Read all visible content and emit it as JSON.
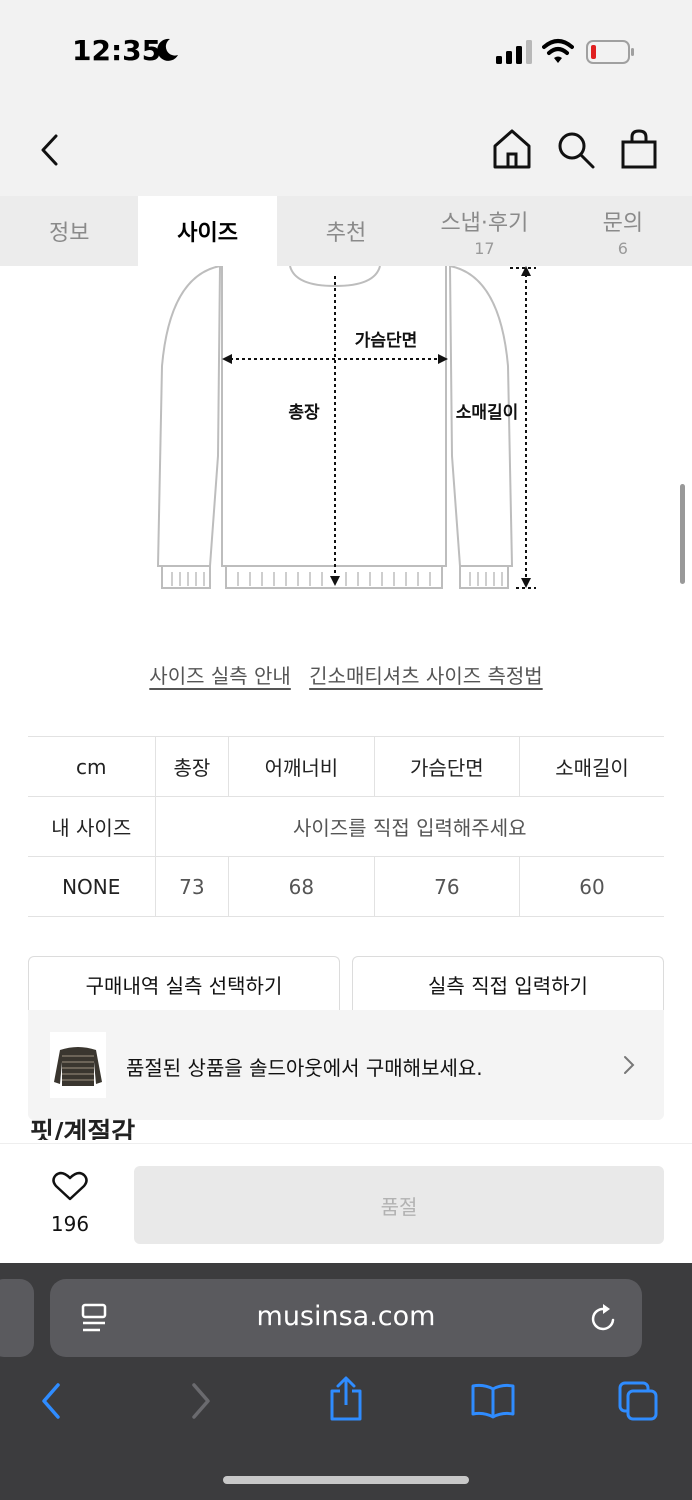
{
  "status": {
    "time": "12:35"
  },
  "tabs": [
    {
      "label": "정보",
      "count": ""
    },
    {
      "label": "사이즈",
      "count": ""
    },
    {
      "label": "추천",
      "count": ""
    },
    {
      "label": "스냅·후기",
      "count": "17"
    },
    {
      "label": "문의",
      "count": "6"
    }
  ],
  "diagram": {
    "chest_label": "가슴단면",
    "length_label": "총장",
    "sleeve_label": "소매길이"
  },
  "links": {
    "guide": "사이즈 실측 안내",
    "measure": "긴소매티셔츠 사이즈 측정법"
  },
  "size_table": {
    "unit": "cm",
    "headers": [
      "총장",
      "어깨너비",
      "가슴단면",
      "소매길이"
    ],
    "my_size_label": "내 사이즈",
    "my_size_placeholder": "사이즈를 직접 입력해주세요",
    "size_name": "NONE",
    "values": [
      "73",
      "68",
      "76",
      "60"
    ]
  },
  "buttons": {
    "purchase_history": "구매내역 실측 선택하기",
    "manual_input": "실측 직접 입력하기"
  },
  "banner": {
    "text": "품절된 상품을 솔드아웃에서 구매해보세요."
  },
  "section": {
    "cut_heading": "핏/계절감"
  },
  "action": {
    "like_count": "196",
    "soldout_label": "품절"
  },
  "browser": {
    "url": "musinsa.com"
  }
}
